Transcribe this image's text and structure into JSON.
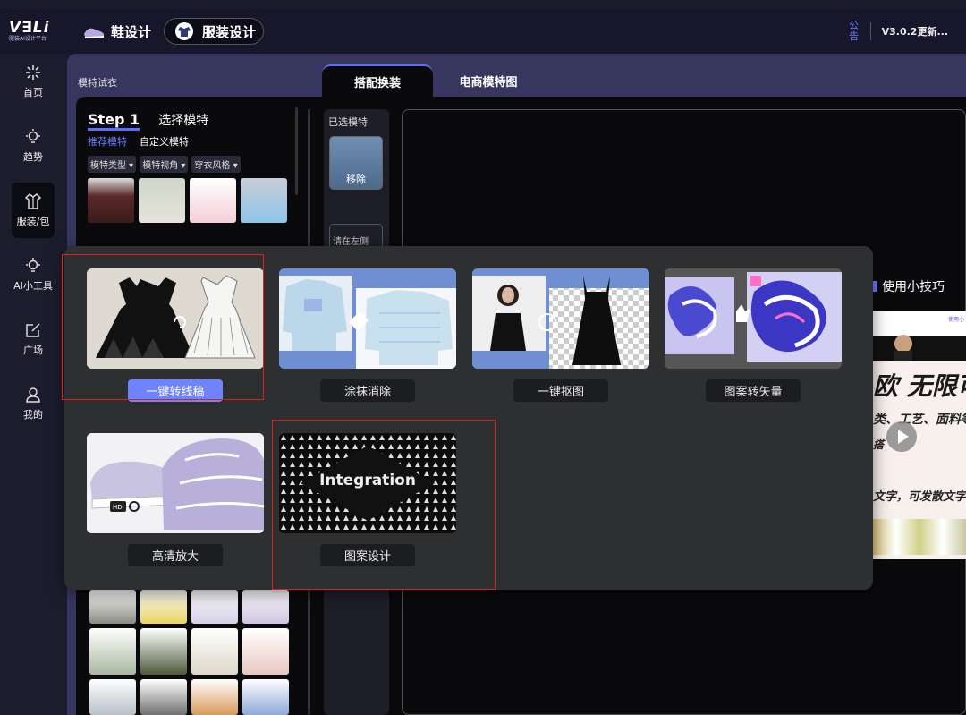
{
  "topbar": {
    "logo_text": "V∃Li",
    "logo_sub": "服装AI设计平台",
    "tabs": [
      {
        "label": "鞋设计",
        "active": false
      },
      {
        "label": "服装设计",
        "active": true
      }
    ],
    "notice_label": "公告",
    "version_label": "V3.0.2更新..."
  },
  "sidebar": {
    "items": [
      {
        "label": "首页",
        "icon": "sparkle-icon"
      },
      {
        "label": "趋势",
        "icon": "bulb-icon"
      },
      {
        "label": "服装/包",
        "icon": "shirt-icon",
        "active": true
      },
      {
        "label": "AI小工具",
        "icon": "bulb-icon"
      },
      {
        "label": "广场",
        "icon": "edit-square-icon"
      },
      {
        "label": "我的",
        "icon": "user-icon"
      }
    ]
  },
  "main": {
    "title": "模特试衣",
    "tabs": [
      {
        "label": "搭配换装",
        "active": true
      },
      {
        "label": "电商模特图",
        "active": false
      }
    ]
  },
  "left_panel": {
    "step_label": "Step 1",
    "step_title": "选择模特",
    "subtabs": [
      "推荐模特",
      "自定义模特"
    ],
    "filters": [
      "模特类型",
      "模特视角",
      "穿衣风格"
    ]
  },
  "selected": {
    "title": "已选模特",
    "remove_label": "移除",
    "hint": "请在左侧"
  },
  "tips_label": "使用小技巧",
  "promo": {
    "badge": "使用小",
    "headline": "欧 无限可",
    "line2": "类、工艺、面料等",
    "line3": "搭",
    "line4": "文字，可发散文字"
  },
  "popup": {
    "tools": [
      {
        "label": "一键转线稿",
        "primary": true
      },
      {
        "label": "涂抹消除",
        "primary": false
      },
      {
        "label": "一键抠图",
        "primary": false
      },
      {
        "label": "图案转矢量",
        "primary": false
      },
      {
        "label": "高清放大",
        "primary": false
      },
      {
        "label": "图案设计",
        "primary": false
      }
    ],
    "hd_badge": "HD",
    "pattern_text": "Integration"
  },
  "colors": {
    "accent": "#6f83ff",
    "highlight_red": "#e0201c",
    "popup_bg": "#2e2f31"
  }
}
